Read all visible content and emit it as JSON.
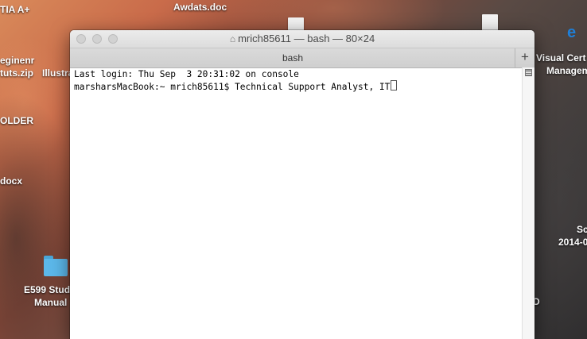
{
  "desktop": {
    "icons": [
      {
        "label": "Awdats.doc"
      },
      {
        "label": "TIA A+"
      },
      {
        "label": "eginenr"
      },
      {
        "label": "tuts.zip"
      },
      {
        "label": "Illustra"
      },
      {
        "label": "OLDER"
      },
      {
        "label": "docx"
      },
      {
        "label": "E599 Stud"
      },
      {
        "label": "Manual"
      },
      {
        "label": "Visual Cert"
      },
      {
        "label": "Managem"
      },
      {
        "label": "Sc"
      },
      {
        "label": "2014-0"
      },
      {
        "label": "D"
      }
    ]
  },
  "window": {
    "title": "mrich85611 — bash — 80×24",
    "tab_label": "bash",
    "new_tab_symbol": "+",
    "lines": [
      "Last login: Thu Sep  3 20:31:02 on console",
      "marsharsMacBook:~ mrich85611$ Technical Support Analyst, IT"
    ]
  },
  "colors": {
    "folder": "#5cb8ea",
    "terminal_bg": "#ffffff",
    "terminal_text": "#000000"
  }
}
